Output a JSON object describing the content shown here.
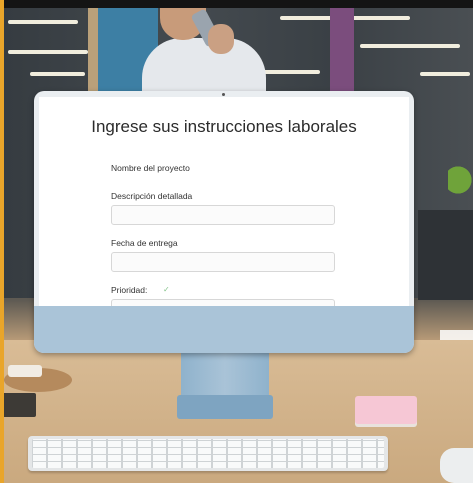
{
  "form": {
    "title": "Ingrese sus instrucciones laborales",
    "fields": [
      {
        "label": "Nombre del proyecto",
        "value": ""
      },
      {
        "label": "Descripción detallada",
        "value": ""
      },
      {
        "label": "Fecha de entrega",
        "value": ""
      },
      {
        "label": "Prioridad:",
        "value": ""
      }
    ]
  },
  "colors": {
    "monitor_chin": "#aac4d8",
    "edge_accent": "#e9a52a",
    "notepad": "#f6c7d5"
  }
}
